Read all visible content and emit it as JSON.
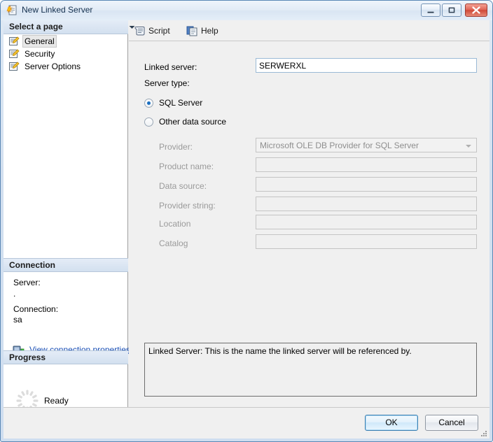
{
  "window": {
    "title": "New Linked Server",
    "title_icon": "linked-server-icon",
    "minimize_glyph": "minimize-icon",
    "maximize_glyph": "maximize-icon",
    "close_glyph": "close-icon",
    "accent_color": "#5a87b5",
    "titlebar_text_color": "#14304e"
  },
  "sidebar": {
    "select_page_header": "Select a page",
    "pages": [
      {
        "label": "General",
        "icon": "page-script-icon",
        "selected": true
      },
      {
        "label": "Security",
        "icon": "page-script-icon",
        "selected": false
      },
      {
        "label": "Server Options",
        "icon": "page-script-icon",
        "selected": false
      }
    ],
    "connection": {
      "header": "Connection",
      "server_label": "Server:",
      "server_value": ".",
      "connection_label": "Connection:",
      "connection_value": "sa",
      "link_text": "View connection properties",
      "link_icon": "server-connection-icon",
      "link_color": "#1a4fb5"
    },
    "progress": {
      "header": "Progress",
      "status": "Ready",
      "spinner_icon": "progress-spinner-icon"
    }
  },
  "toolbar": {
    "script_label": "Script",
    "script_icon": "script-scroll-icon",
    "script_dropdown_icon": "chevron-down-icon",
    "help_label": "Help",
    "help_icon": "help-pages-icon"
  },
  "form": {
    "linked_server_label": "Linked server:",
    "linked_server_value": "SERWERXL",
    "linked_server_placeholder": "",
    "server_type_label": "Server type:",
    "radios": [
      {
        "label": "SQL Server",
        "checked": true
      },
      {
        "label": "Other data source",
        "checked": false
      }
    ],
    "provider_label": "Provider:",
    "provider_value": "Microsoft OLE DB Provider for SQL Server",
    "provider_dropdown_icon": "chevron-down-icon",
    "fields": [
      {
        "label": "Product name:",
        "value": ""
      },
      {
        "label": "Data source:",
        "value": ""
      },
      {
        "label": "Provider string:",
        "value": ""
      },
      {
        "label": "Location",
        "value": ""
      },
      {
        "label": "Catalog",
        "value": ""
      }
    ]
  },
  "help_panel": {
    "text": "Linked Server: This is the name the linked server will be referenced by."
  },
  "footer": {
    "ok_label": "OK",
    "cancel_label": "Cancel",
    "resize_grip_icon": "resize-grip-icon"
  }
}
